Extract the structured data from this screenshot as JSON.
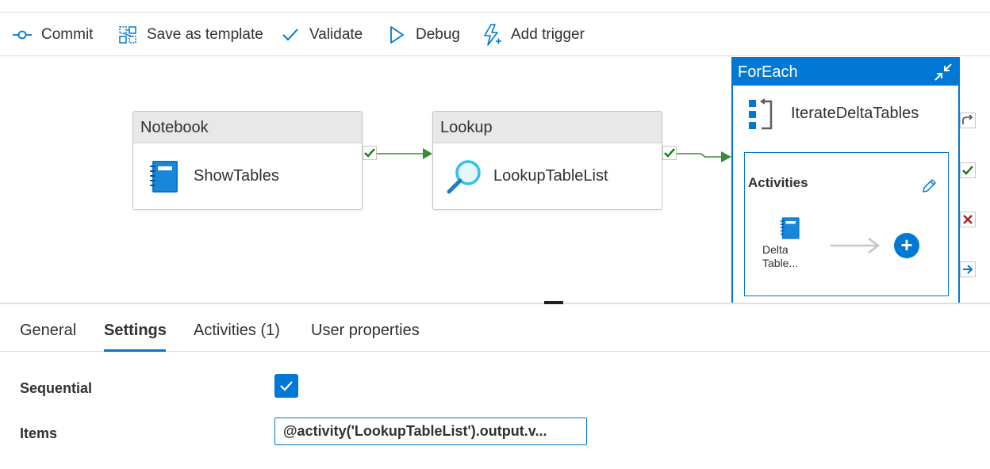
{
  "toolbar": {
    "commit_label": "Commit",
    "save_template_label": "Save as template",
    "validate_label": "Validate",
    "debug_label": "Debug",
    "add_trigger_label": "Add trigger"
  },
  "pipeline": {
    "notebook": {
      "type_label": "Notebook",
      "name": "ShowTables"
    },
    "lookup": {
      "type_label": "Lookup",
      "name": "LookupTableList"
    },
    "foreach": {
      "type_label": "ForEach",
      "name": "IterateDeltaTables",
      "activities_title": "Activities",
      "inner_activity_line1": "Delta",
      "inner_activity_line2": "Table..."
    }
  },
  "tabs": [
    {
      "label": "General"
    },
    {
      "label": "Settings",
      "active": true
    },
    {
      "label": "Activities (1)"
    },
    {
      "label": "User properties"
    }
  ],
  "settings": {
    "sequential_label": "Sequential",
    "sequential_checked": true,
    "items_label": "Items",
    "items_value": "@activity('LookupTableList').output.v..."
  },
  "colors": {
    "accent": "#0078d4",
    "success": "#107c10",
    "failure": "#a4262c",
    "connector": "#3a8a3a"
  }
}
